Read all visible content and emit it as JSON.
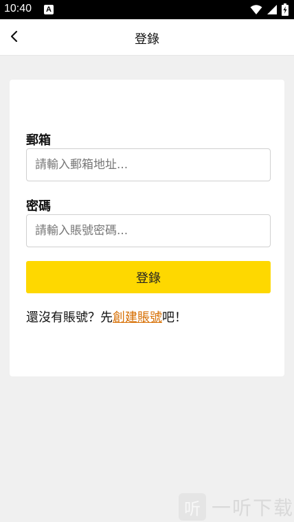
{
  "status_bar": {
    "time": "10:40",
    "notification_letter": "A",
    "icons": [
      "wifi-icon",
      "signal-icon",
      "battery-icon"
    ]
  },
  "header": {
    "title": "登錄"
  },
  "form": {
    "email_label": "郵箱",
    "email_placeholder": "請輸入郵箱地址...",
    "password_label": "密碼",
    "password_placeholder": "請輸入賬號密碼...",
    "login_button": "登錄",
    "register_prefix": "還沒有賬號？先",
    "register_link": "創建賬號",
    "register_suffix": "吧！"
  },
  "watermark": {
    "logo_char": "听",
    "text": "一听下载"
  },
  "colors": {
    "accent": "#fed800",
    "link": "#d66d00",
    "background": "#f0f0f0"
  }
}
